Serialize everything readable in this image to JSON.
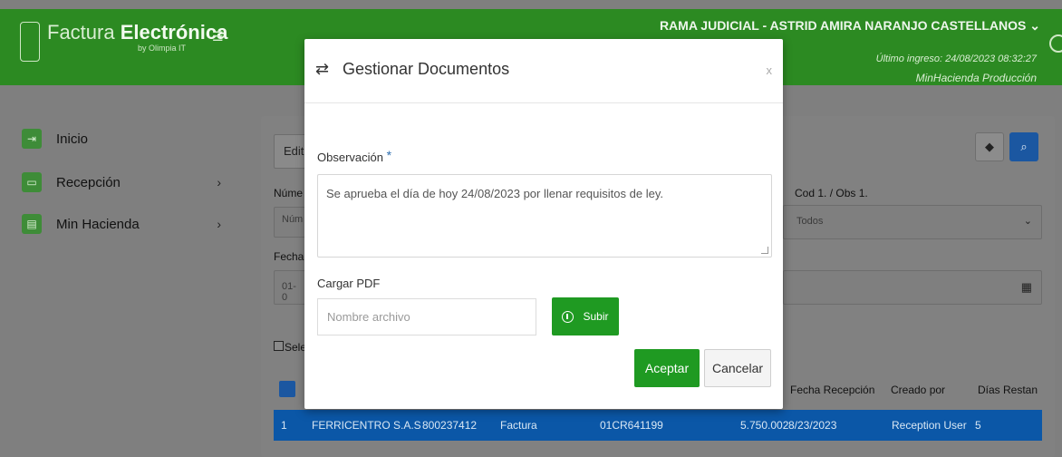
{
  "header": {
    "brand_light": "Factura ",
    "brand_bold": "Electrónica",
    "brand_sub": "by Olimpia IT",
    "user_name": "RAMA JUDICIAL - ASTRID AMIRA NARANJO CASTELLANOS ⌄",
    "last_login": "Último ingreso: 24/08/2023 08:32:27",
    "environment": "MinHacienda Producción"
  },
  "sidebar": {
    "items": [
      {
        "label": "Inicio",
        "icon": "login-icon",
        "chevron": ""
      },
      {
        "label": "Recepción",
        "icon": "inbox-icon",
        "chevron": "›"
      },
      {
        "label": "Min Hacienda",
        "icon": "document-icon",
        "chevron": "›"
      }
    ]
  },
  "background": {
    "edit_button": "Edit",
    "numero_label": "Núme",
    "numero_placeholder": "Núm",
    "fecha_label": "Fecha",
    "fecha_value": "01-0",
    "cod_label": "Cod 1. / Obs 1.",
    "cod_value": "Todos",
    "select_all": "Sele",
    "headers": [
      "Fecha Recepción",
      "Creado por",
      "Días Restan"
    ],
    "row": {
      "num": "1",
      "company": "FERRICENTRO S.A.S",
      "nit": "800237412",
      "type": "Factura",
      "doc": "01CR641199",
      "amount": "5.750.002",
      "date": "8/23/2023",
      "created_by": "Reception User",
      "days": "5"
    }
  },
  "modal": {
    "title": "Gestionar Documentos",
    "close": "x",
    "obs_label": "Observación",
    "required_mark": "*",
    "obs_value": "Se aprueba el día de hoy 24/08/2023 por llenar requisitos de ley.",
    "pdf_label": "Cargar PDF",
    "file_placeholder": "Nombre archivo",
    "upload_label": "Subir",
    "accept_label": "Aceptar",
    "cancel_label": "Cancelar"
  },
  "colors": {
    "header_green": "#2c8a22",
    "button_green": "#1f9a22",
    "row_blue": "#0b57a7",
    "search_blue": "#1b57a1"
  }
}
